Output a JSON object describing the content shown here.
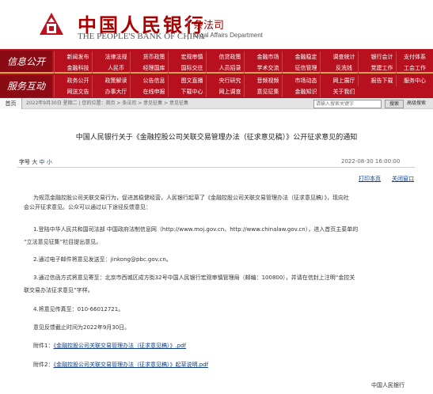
{
  "header": {
    "logo_cn": "中国人民银行",
    "logo_en": "THE PEOPLE'S BANK OF CHINA",
    "dept_cn": "条法司",
    "dept_en": "Legal Affairs Department"
  },
  "nav": {
    "info_label": "信息公开",
    "service_label": "服务互动",
    "rows": [
      [
        "新闻发布",
        "法律法规",
        "货币政策",
        "宏观审慎",
        "信贷政策",
        "金融市场",
        "金融稳定",
        "调查统计",
        "银行会计",
        "支付体系"
      ],
      [
        "金融科技",
        "人民币",
        "经理国库",
        "国际交往",
        "人员招录",
        "学术交流",
        "征信管理",
        "反洗钱",
        "党建工作",
        "工会工作"
      ],
      [
        "政务公开",
        "政策解读",
        "公告信息",
        "图文直播",
        "央行研究",
        "音频视频",
        "市场动态",
        "网上展厅",
        "报告下载",
        "服务中心"
      ],
      [
        "网送文告",
        "办事大厅",
        "在线申报",
        "下载中心",
        "网上调查",
        "意见征集",
        "金融知识",
        "关于我们",
        "",
        ""
      ]
    ]
  },
  "breadcrumb": {
    "home": "首页",
    "text": "2022年9月30日 星期二 | 您的位置：首页 > 条法司 > 意见征集 > 意见征集",
    "search_placeholder": "请输入搜索关键字",
    "search_button": "搜索",
    "advanced_search": "高级搜索"
  },
  "article": {
    "title": "中国人民银行关于《金融控股公司关联交易管理办法（征求意见稿）》公开征求意见的通知",
    "font_size_label": "字号",
    "font_sizes": [
      "大",
      "中",
      "小"
    ],
    "date": "2022-08-30 16:00:00",
    "print": "打印本页",
    "close": "关闭窗口",
    "p1_line1": "为规范金融控股公司关联交易行为，促进其稳健经营，人民银行起草了《金融控股公司关联交易管理办法（征求意见稿）》，现向社",
    "p1_line2": "会公开征求意见。公众可以通过以下途径反馈意见：",
    "p2_line1": "1.登陆中华人民共和国司法部 中国政府法制信息网（http://www.moj.gov.cn、http://www.chinalaw.gov.cn），进入首页主菜单的",
    "p2_line2": "“立法意见征集”栏目提出意见。",
    "p3": "2.通过电子邮件将意见发送至：jinkong@pbc.gov.cn。",
    "p4_line1": "3.通过信函方式将意见寄至：北京市西城区成方街32号中国人民银行宏观审慎管理局（邮编：100800），并请在信封上注明“金控关",
    "p4_line2": "联交易办法征求意见”字样。",
    "p5": "4.将意见传真至：010-66012721。",
    "p6": "意见反馈截止时间为2022年9月30日。",
    "att1_label": "附件1：",
    "att1_link": "《金融控股公司关联交易管理办法（征求意见稿）》.pdf",
    "att2_label": "附件2：",
    "att2_link": "《金融控股公司关联交易管理办法（征求意见稿）》起草说明.pdf",
    "signature": "中国人民银行"
  },
  "colors": {
    "brand_red": "#b7101e",
    "dark_red": "#8a0b13",
    "link_blue": "#0b3c8c",
    "gold": "#d7a64d"
  }
}
